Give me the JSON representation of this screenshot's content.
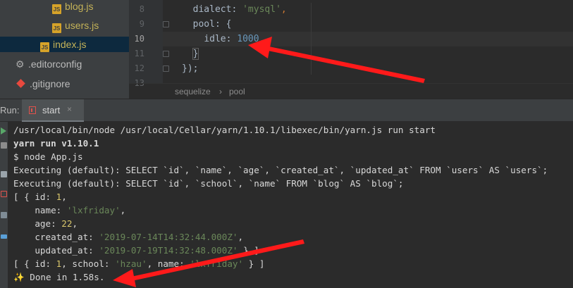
{
  "tree": {
    "items": [
      {
        "label": "blog.js",
        "icon": "js-file-icon"
      },
      {
        "label": "users.js",
        "icon": "js-file-icon"
      },
      {
        "label": "index.js",
        "icon": "js-file-icon",
        "selected": true
      },
      {
        "label": ".editorconfig",
        "icon": "gear-icon"
      },
      {
        "label": ".gitignore",
        "icon": "git-icon"
      }
    ]
  },
  "editor": {
    "line_numbers": [
      "8",
      "9",
      "10",
      "11",
      "12",
      "13"
    ],
    "current_line": "10",
    "lines": [
      {
        "indent": "  ",
        "key": "dialect",
        "value": "'mysql'",
        "tail": ","
      },
      {
        "indent": "  ",
        "key": "pool",
        "value": "",
        "tail": " {"
      },
      {
        "indent": "    ",
        "key": "idle",
        "value": "1000",
        "tail": ","
      },
      {
        "indent": "  ",
        "text": "}"
      },
      {
        "indent": "",
        "text": "});"
      }
    ],
    "breadcrumb": [
      "sequelize",
      "pool"
    ],
    "breadcrumb_separator": "›"
  },
  "run_panel": {
    "label": "Run:",
    "tab_label": "start",
    "tab_close": "×",
    "tab_icon": "npm-icon"
  },
  "console": {
    "lines": [
      "/usr/local/bin/node /usr/local/Cellar/yarn/1.10.1/libexec/bin/yarn.js run start",
      "yarn run v1.10.1",
      "$ node App.js",
      "Executing (default): SELECT `id`, `name`, `age`, `created_at`, `updated_at` FROM `users` AS `users`;",
      "Executing (default): SELECT `id`, `school`, `name` FROM `blog` AS `blog`;"
    ],
    "user_record": {
      "open": "[ { id: ",
      "id": "1",
      "name_key": "name: ",
      "name": "'lxfriday'",
      "age_key": "age: ",
      "age": "22",
      "created_key": "created_at: ",
      "created": "'2019-07-14T14:32:44.000Z'",
      "updated_key": "updated_at: ",
      "updated": "'2019-07-19T14:32:48.000Z'",
      "close": " } ]"
    },
    "blog_record": {
      "open": "[ { id: ",
      "id": "1",
      "school_key": ", school: ",
      "school": "'hzau'",
      "name_key": ", name: ",
      "name": "'lxfriday'",
      "close": " } ]"
    },
    "done_icon": "✨",
    "done_text": " Done in 1.58s."
  },
  "colors": {
    "annotation_arrow": "#ff1a1a",
    "string": "#6a8759",
    "number": "#6897bb"
  }
}
